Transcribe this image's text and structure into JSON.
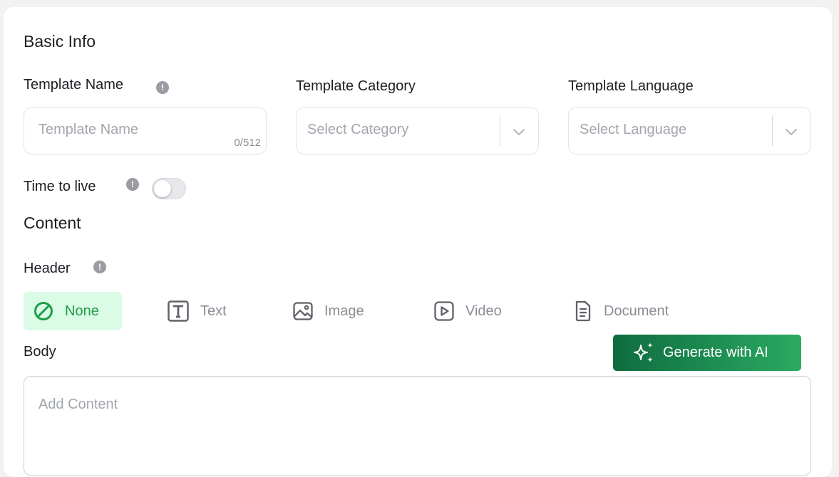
{
  "basic_info": {
    "title": "Basic Info"
  },
  "template_name": {
    "label": "Template Name",
    "placeholder": "Template Name",
    "counter": "0/512"
  },
  "template_category": {
    "label": "Template Category",
    "placeholder": "Select Category"
  },
  "template_language": {
    "label": "Template Language",
    "placeholder": "Select Language"
  },
  "ttl": {
    "label": "Time to live",
    "enabled": false
  },
  "content": {
    "title": "Content"
  },
  "header": {
    "label": "Header",
    "selected": "None",
    "tabs": [
      {
        "label": "None",
        "icon": "ban-icon"
      },
      {
        "label": "Text",
        "icon": "text-icon"
      },
      {
        "label": "Image",
        "icon": "image-icon"
      },
      {
        "label": "Video",
        "icon": "video-icon"
      },
      {
        "label": "Document",
        "icon": "document-icon"
      }
    ]
  },
  "body": {
    "label": "Body",
    "placeholder": "Add Content",
    "ai_button": "Generate with AI"
  },
  "colors": {
    "accent": "#1f9d47",
    "active_tab_bg": "#dafbe6",
    "ai_gradient_start": "#0e6c3f",
    "ai_gradient_end": "#2baa62"
  }
}
